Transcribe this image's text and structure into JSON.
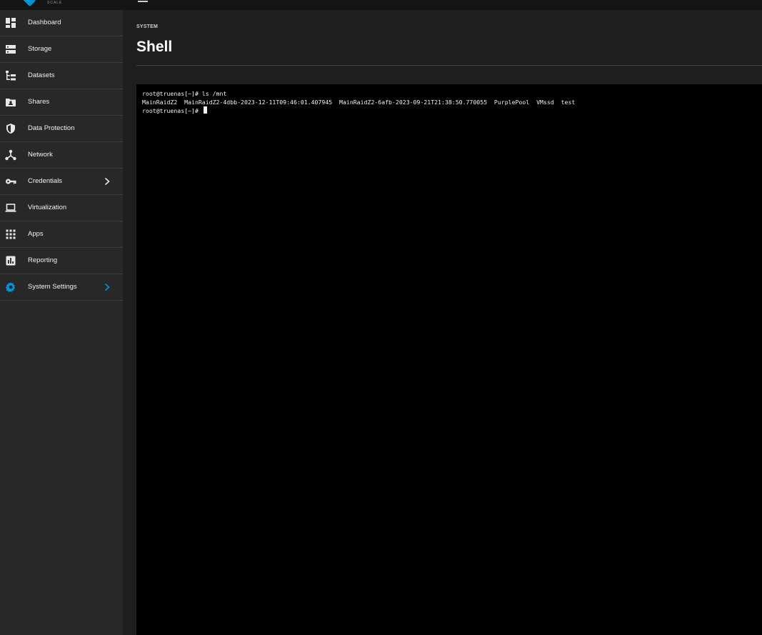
{
  "header": {
    "logo_subtext": "SCALE"
  },
  "sidebar": {
    "items": [
      {
        "label": "Dashboard",
        "icon": "dashboard-icon"
      },
      {
        "label": "Storage",
        "icon": "storage-icon"
      },
      {
        "label": "Datasets",
        "icon": "datasets-icon"
      },
      {
        "label": "Shares",
        "icon": "shares-icon"
      },
      {
        "label": "Data Protection",
        "icon": "shield-icon"
      },
      {
        "label": "Network",
        "icon": "network-icon"
      },
      {
        "label": "Credentials",
        "icon": "key-icon"
      },
      {
        "label": "Virtualization",
        "icon": "laptop-icon"
      },
      {
        "label": "Apps",
        "icon": "apps-grid-icon"
      },
      {
        "label": "Reporting",
        "icon": "reporting-icon"
      },
      {
        "label": "System Settings",
        "icon": "gear-icon"
      }
    ],
    "active_color": "#0095d5"
  },
  "main": {
    "breadcrumb": "SYSTEM",
    "title": "Shell"
  },
  "terminal": {
    "lines": [
      "root@truenas[~]# ls /mnt",
      "MainRaidZ2  MainRaidZ2-4dbb-2023-12-11T09:46:01.407945  MainRaidZ2-6afb-2023-09-21T21:38:50.770055  PurplePool  VMssd  test",
      "root@truenas[~]# "
    ]
  }
}
